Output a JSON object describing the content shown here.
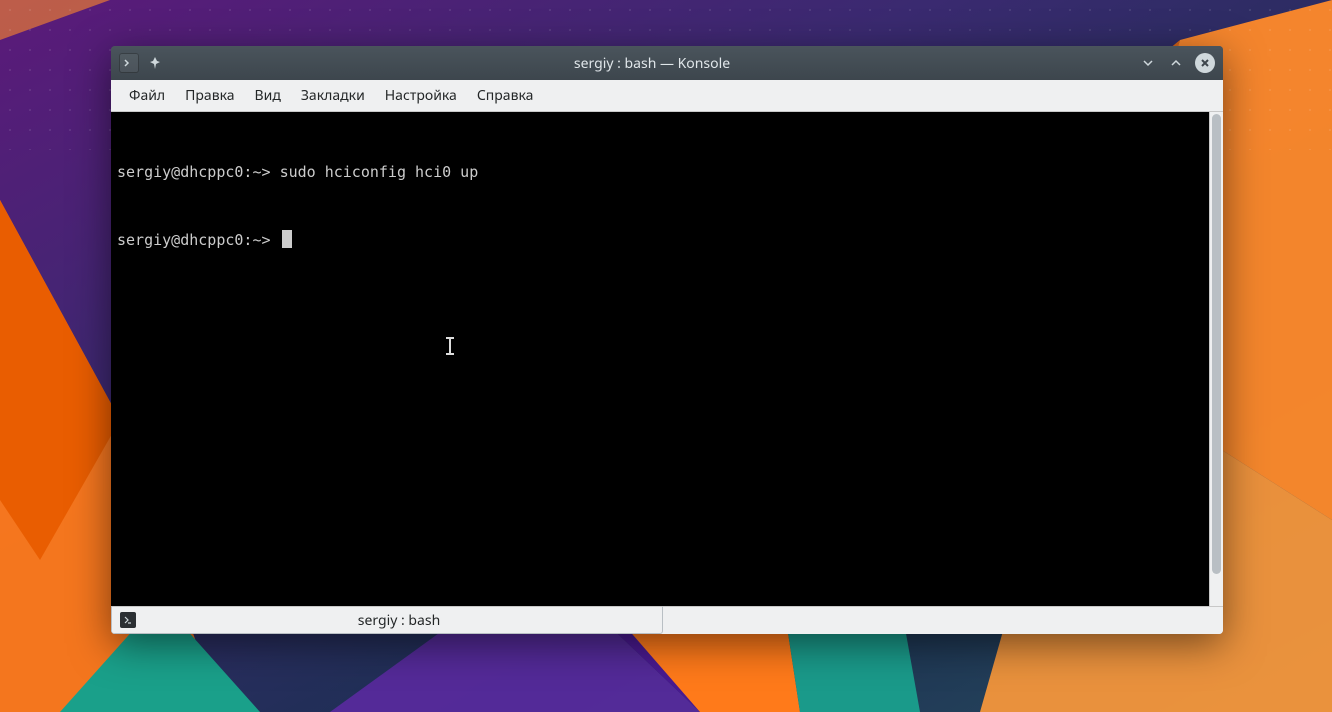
{
  "window": {
    "title": "sergiy : bash — Konsole"
  },
  "menu": {
    "file": "Файл",
    "edit": "Правка",
    "view": "Вид",
    "bookmarks": "Закладки",
    "settings": "Настройка",
    "help": "Справка"
  },
  "terminal": {
    "lines": [
      {
        "prompt": "sergiy@dhcppc0:~> ",
        "command": "sudo hciconfig hci0 up"
      },
      {
        "prompt": "sergiy@dhcppc0:~> ",
        "command": ""
      }
    ]
  },
  "tab": {
    "label": "sergiy : bash"
  },
  "icons": {
    "terminal_glyph": ">_",
    "pin_glyph": "📌",
    "close_glyph": "✕"
  }
}
